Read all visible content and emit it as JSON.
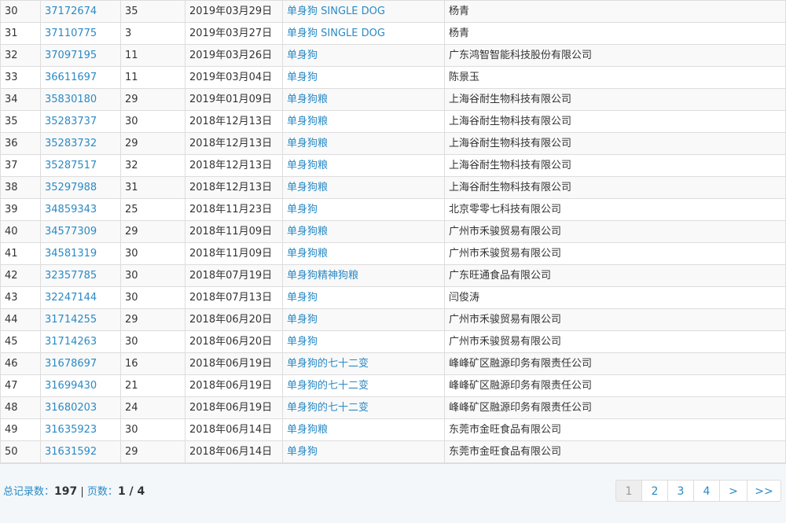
{
  "rows": [
    {
      "idx": "30",
      "reg_no": "37172674",
      "class": "35",
      "date": "2019年03月29日",
      "name": "单身狗 SINGLE DOG",
      "applicant": "杨青"
    },
    {
      "idx": "31",
      "reg_no": "37110775",
      "class": "3",
      "date": "2019年03月27日",
      "name": "单身狗 SINGLE DOG",
      "applicant": "杨青"
    },
    {
      "idx": "32",
      "reg_no": "37097195",
      "class": "11",
      "date": "2019年03月26日",
      "name": "单身狗",
      "applicant": "广东鸿智智能科技股份有限公司"
    },
    {
      "idx": "33",
      "reg_no": "36611697",
      "class": "11",
      "date": "2019年03月04日",
      "name": "单身狗",
      "applicant": "陈景玉"
    },
    {
      "idx": "34",
      "reg_no": "35830180",
      "class": "29",
      "date": "2019年01月09日",
      "name": "单身狗粮",
      "applicant": "上海谷耐生物科技有限公司"
    },
    {
      "idx": "35",
      "reg_no": "35283737",
      "class": "30",
      "date": "2018年12月13日",
      "name": "单身狗粮",
      "applicant": "上海谷耐生物科技有限公司"
    },
    {
      "idx": "36",
      "reg_no": "35283732",
      "class": "29",
      "date": "2018年12月13日",
      "name": "单身狗粮",
      "applicant": "上海谷耐生物科技有限公司"
    },
    {
      "idx": "37",
      "reg_no": "35287517",
      "class": "32",
      "date": "2018年12月13日",
      "name": "单身狗粮",
      "applicant": "上海谷耐生物科技有限公司"
    },
    {
      "idx": "38",
      "reg_no": "35297988",
      "class": "31",
      "date": "2018年12月13日",
      "name": "单身狗粮",
      "applicant": "上海谷耐生物科技有限公司"
    },
    {
      "idx": "39",
      "reg_no": "34859343",
      "class": "25",
      "date": "2018年11月23日",
      "name": "单身狗",
      "applicant": "北京零零七科技有限公司"
    },
    {
      "idx": "40",
      "reg_no": "34577309",
      "class": "29",
      "date": "2018年11月09日",
      "name": "单身狗粮",
      "applicant": "广州市禾骏贸易有限公司"
    },
    {
      "idx": "41",
      "reg_no": "34581319",
      "class": "30",
      "date": "2018年11月09日",
      "name": "单身狗粮",
      "applicant": "广州市禾骏贸易有限公司"
    },
    {
      "idx": "42",
      "reg_no": "32357785",
      "class": "30",
      "date": "2018年07月19日",
      "name": "单身狗精神狗粮",
      "applicant": "广东旺通食品有限公司"
    },
    {
      "idx": "43",
      "reg_no": "32247144",
      "class": "30",
      "date": "2018年07月13日",
      "name": "单身狗",
      "applicant": "闫俊涛"
    },
    {
      "idx": "44",
      "reg_no": "31714255",
      "class": "29",
      "date": "2018年06月20日",
      "name": "单身狗",
      "applicant": "广州市禾骏贸易有限公司"
    },
    {
      "idx": "45",
      "reg_no": "31714263",
      "class": "30",
      "date": "2018年06月20日",
      "name": "单身狗",
      "applicant": "广州市禾骏贸易有限公司"
    },
    {
      "idx": "46",
      "reg_no": "31678697",
      "class": "16",
      "date": "2018年06月19日",
      "name": "单身狗的七十二变",
      "applicant": "峰峰矿区融源印务有限责任公司"
    },
    {
      "idx": "47",
      "reg_no": "31699430",
      "class": "21",
      "date": "2018年06月19日",
      "name": "单身狗的七十二变",
      "applicant": "峰峰矿区融源印务有限责任公司"
    },
    {
      "idx": "48",
      "reg_no": "31680203",
      "class": "24",
      "date": "2018年06月19日",
      "name": "单身狗的七十二变",
      "applicant": "峰峰矿区融源印务有限责任公司"
    },
    {
      "idx": "49",
      "reg_no": "31635923",
      "class": "30",
      "date": "2018年06月14日",
      "name": "单身狗粮",
      "applicant": "东莞市金旺食品有限公司"
    },
    {
      "idx": "50",
      "reg_no": "31631592",
      "class": "29",
      "date": "2018年06月14日",
      "name": "单身狗",
      "applicant": "东莞市金旺食品有限公司"
    }
  ],
  "footer": {
    "total_label": "总记录数：",
    "total_value": "197",
    "separator": "|",
    "pages_label": "页数：",
    "pages_value": "1 / 4"
  },
  "pagination": [
    {
      "label": "1",
      "active": true
    },
    {
      "label": "2",
      "active": false
    },
    {
      "label": "3",
      "active": false
    },
    {
      "label": "4",
      "active": false
    },
    {
      "label": ">",
      "active": false
    },
    {
      "label": ">>",
      "active": false
    }
  ],
  "colors": {
    "link": "#2a8ac5",
    "border": "#dddddd",
    "footer_bg": "#f3f7fa"
  }
}
